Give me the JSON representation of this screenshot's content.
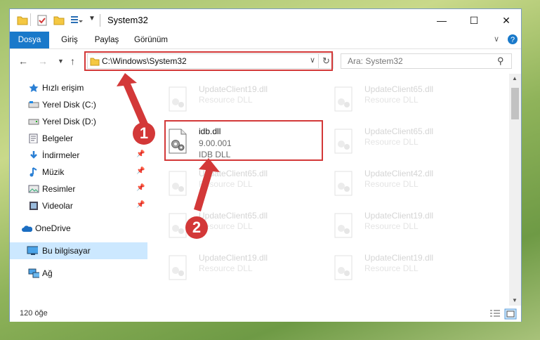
{
  "window": {
    "title": "System32"
  },
  "ribbon": {
    "tabs": [
      "Dosya",
      "Giriş",
      "Paylaş",
      "Görünüm"
    ]
  },
  "address": {
    "path": "C:\\Windows\\System32"
  },
  "search": {
    "placeholder": "Ara: System32"
  },
  "sidebar": {
    "items": [
      {
        "label": "Hızlı erişim",
        "icon": "star-icon"
      },
      {
        "label": "Yerel Disk (C:)",
        "icon": "drive-icon"
      },
      {
        "label": "Yerel Disk (D:)",
        "icon": "drive-icon"
      },
      {
        "label": "Belgeler",
        "icon": "documents-icon"
      },
      {
        "label": "İndirmeler",
        "icon": "download-icon"
      },
      {
        "label": "Müzik",
        "icon": "music-icon"
      },
      {
        "label": "Resimler",
        "icon": "pictures-icon"
      },
      {
        "label": "Videolar",
        "icon": "video-icon"
      },
      {
        "label": "OneDrive",
        "icon": "cloud-icon"
      },
      {
        "label": "Bu bilgisayar",
        "icon": "computer-icon"
      },
      {
        "label": "Ağ",
        "icon": "network-icon"
      }
    ]
  },
  "files": {
    "highlighted": {
      "name": "idb.dll",
      "version": "9.00.001",
      "type": "IDB DLL"
    },
    "left_column": [
      {
        "name": "UpdateClient19.dll",
        "type": "Resource DLL"
      },
      {
        "name": "UpdateClient65.dll",
        "type": "Resource DLL"
      },
      {
        "name": "UpdateClient65.dll",
        "type": "Resource DLL"
      },
      {
        "name": "UpdateClient19.dll",
        "type": "Resource DLL"
      }
    ],
    "right_column": [
      {
        "name": "UpdateClient65.dll",
        "type": "Resource DLL"
      },
      {
        "name": "UpdateClient65.dll",
        "type": "Resource DLL"
      },
      {
        "name": "UpdateClient42.dll",
        "type": "Resource DLL"
      },
      {
        "name": "UpdateClient19.dll",
        "type": "Resource DLL"
      },
      {
        "name": "UpdateClient19.dll",
        "type": "Resource DLL"
      }
    ]
  },
  "status": {
    "item_count": "120 öğe"
  },
  "callouts": {
    "one": "1",
    "two": "2"
  },
  "colors": {
    "accent": "#1979ca",
    "highlight": "#d33838",
    "selected": "#cce8ff"
  }
}
